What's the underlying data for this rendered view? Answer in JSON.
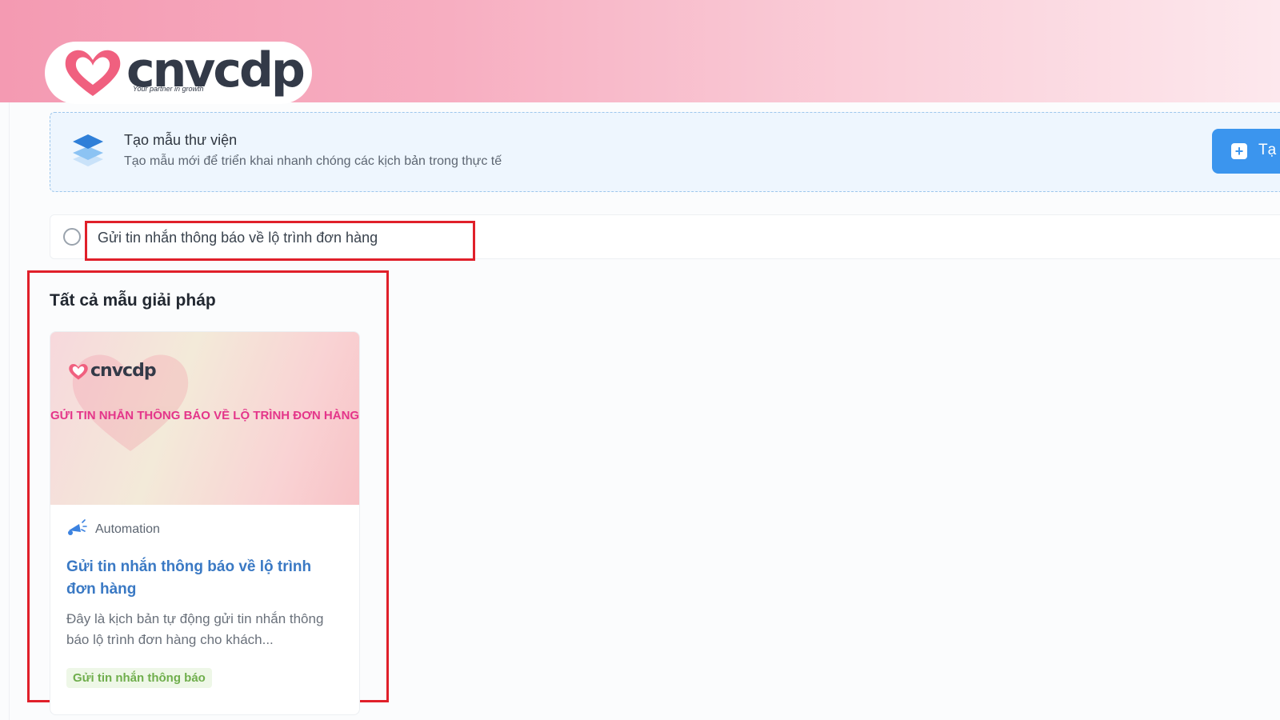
{
  "brand": {
    "name": "cnvcdp",
    "tagline": "Your partner in growth",
    "heart_color": "#f0607f",
    "banner_color": "#f49ab2"
  },
  "library_banner": {
    "title": "Tạo mẫu thư viện",
    "subtitle": "Tạo mẫu mới để triển khai nhanh chóng các kịch bản trong thực tế",
    "create_button_label": "Tạ",
    "create_button_icon": "plus-icon",
    "icon": "layers-icon",
    "accent_color": "#3b95ee"
  },
  "search": {
    "value": "Gửi tin nhắn thông báo về lộ trình đơn hàng",
    "highlight_color": "#e0202a"
  },
  "section": {
    "title": "Tất cả mẫu giải pháp"
  },
  "templates": [
    {
      "thumbnail_brand": "cnvcdp",
      "thumbnail_title": "GỬI TIN NHẮN THÔNG BÁO VỀ LỘ TRÌNH ĐƠN HÀNG",
      "category": "Automation",
      "category_icon": "megaphone-icon",
      "title": "Gửi tin nhắn thông báo về lộ trình đơn hàng",
      "description": "Đây là kịch bản tự động gửi tin nhắn thông báo lộ trình đơn hàng cho khách...",
      "tag": "Gửi tin nhắn thông báo"
    }
  ]
}
